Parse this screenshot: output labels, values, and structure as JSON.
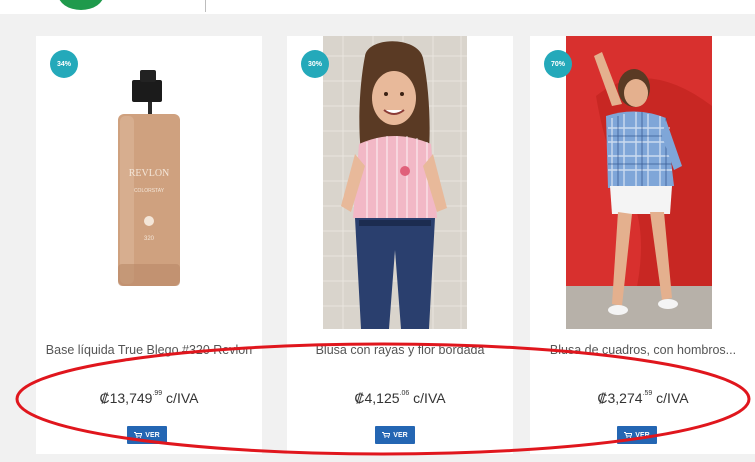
{
  "colors": {
    "badge": "#24a9ba",
    "button": "#2466b3",
    "annotation": "#e0161d",
    "brand": "#1f9a4c"
  },
  "products": [
    {
      "badge": "34%",
      "name": "Base líquida True Blego #320 Revlon",
      "price_main": "₡13,749",
      "price_cents": ".99",
      "price_suffix": " c/IVA",
      "button_label": "VER",
      "button_icon": "cart-icon"
    },
    {
      "badge": "30%",
      "name": "Blusa con rayas y flor bordada",
      "price_main": "₡4,125",
      "price_cents": ".06",
      "price_suffix": " c/IVA",
      "button_label": "VER",
      "button_icon": "cart-icon"
    },
    {
      "badge": "70%",
      "name": "Blusa de cuadros, con hombros...",
      "price_main": "₡3,274",
      "price_cents": ".59",
      "price_suffix": " c/IVA",
      "button_label": "VER",
      "button_icon": "cart-icon"
    }
  ]
}
